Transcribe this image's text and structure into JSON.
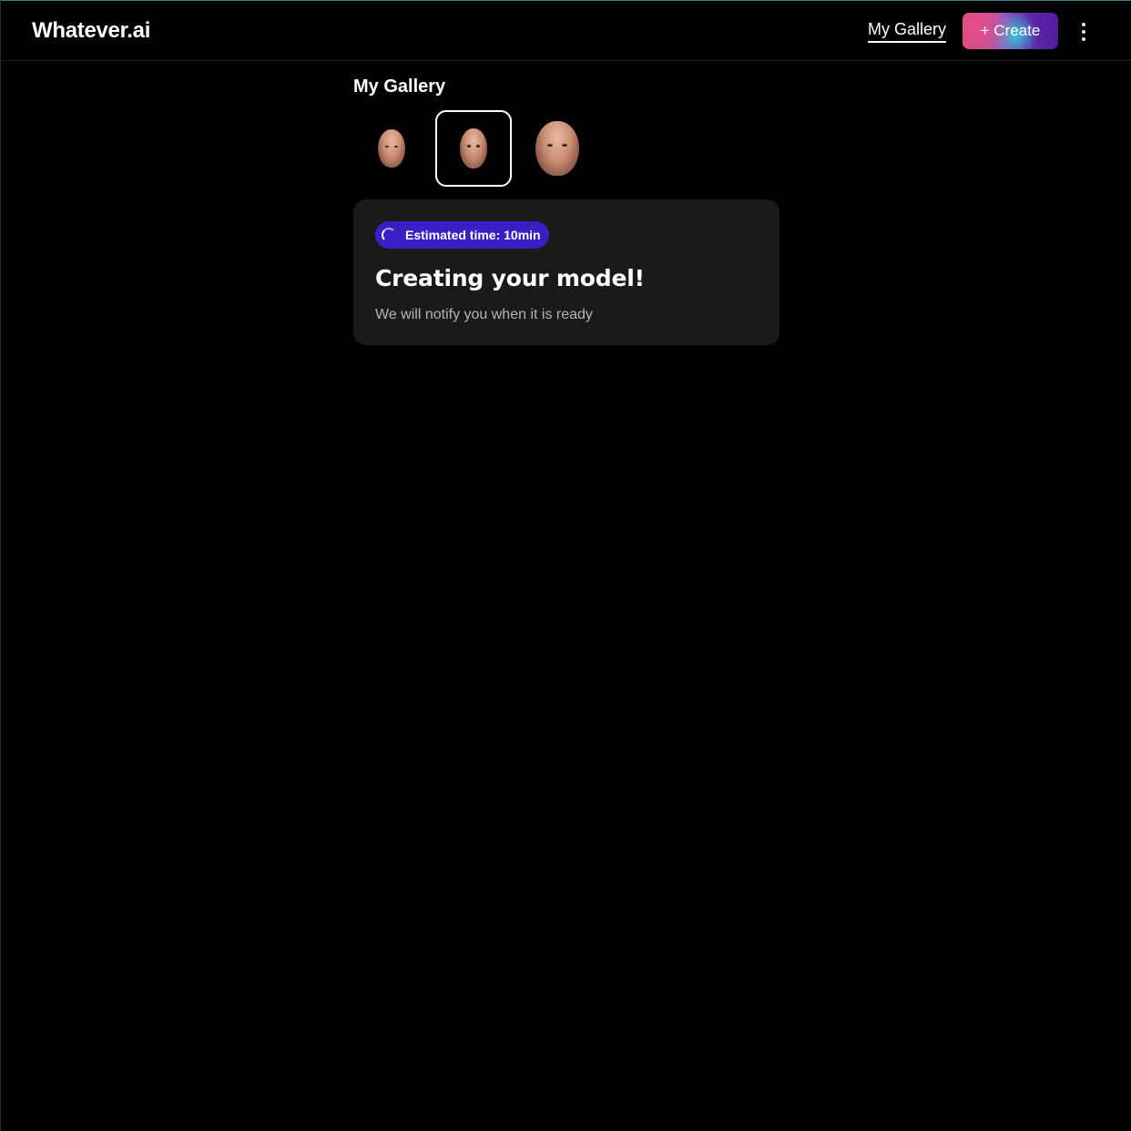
{
  "header": {
    "logo": "Whatever.ai",
    "nav_gallery_label": "My Gallery",
    "create_label": "+ Create",
    "menu_icon": "kebab-vertical-icon"
  },
  "gallery": {
    "title": "My Gallery",
    "thumbnails": [
      {
        "alt": "model-thumbnail-1",
        "selected": false
      },
      {
        "alt": "model-thumbnail-2",
        "selected": true
      },
      {
        "alt": "model-thumbnail-3",
        "selected": false
      }
    ]
  },
  "status": {
    "badge_label": "Estimated time: 10min",
    "badge_icon": "spinner-icon",
    "badge_color": "#3b1fc4",
    "title": "Creating your model!",
    "subtitle": "We will notify you when it is ready"
  }
}
